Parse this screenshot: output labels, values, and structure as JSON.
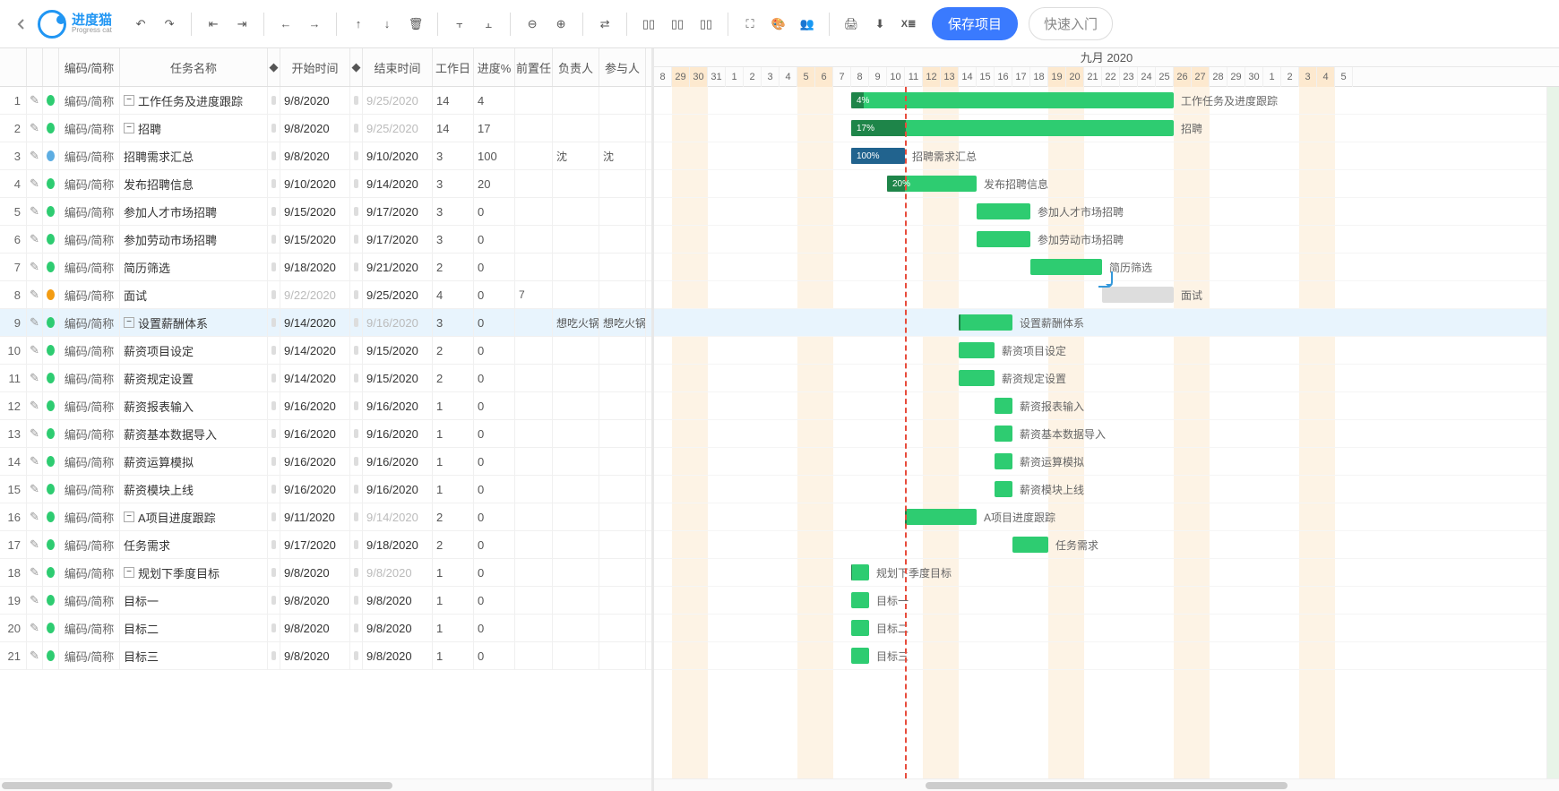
{
  "brand": {
    "zh": "进度猫",
    "en": "Progress cat"
  },
  "toolbar": {
    "save": "保存项目",
    "quick": "快速入门",
    "icons": [
      "undo",
      "redo",
      "outdent",
      "indent",
      "left",
      "right",
      "up",
      "down",
      "delete",
      "align-top",
      "align-bottom",
      "zoom-out",
      "zoom-in",
      "link",
      "col1",
      "col2",
      "col3",
      "fullscreen",
      "palette",
      "team",
      "print",
      "download",
      "excel"
    ]
  },
  "columns": {
    "code": "编码/简称",
    "name": "任务名称",
    "start": "开始时间",
    "end": "结束时间",
    "wd": "工作日",
    "pg": "进度%",
    "pre": "前置任",
    "mgr": "负责人",
    "mem": "参与人"
  },
  "rows": [
    {
      "n": 1,
      "color": "green",
      "lvl": 0,
      "exp": true,
      "name": "工作任务及进度跟踪",
      "s": "9/8/2020",
      "e": "9/25/2020",
      "edim": true,
      "wd": "14",
      "pg": "4",
      "pgdim": true,
      "start": 8,
      "end": 25,
      "prog": 4,
      "summary": true
    },
    {
      "n": 2,
      "color": "green",
      "lvl": 1,
      "exp": true,
      "name": "招聘",
      "s": "9/8/2020",
      "e": "9/25/2020",
      "edim": true,
      "wd": "14",
      "pg": "17",
      "start": 8,
      "end": 25,
      "prog": 17,
      "summary": true
    },
    {
      "n": 3,
      "color": "blue",
      "lvl": 2,
      "name": "招聘需求汇总",
      "s": "9/8/2020",
      "e": "9/10/2020",
      "wd": "3",
      "pg": "100",
      "mgr": "沈",
      "mem": "沈",
      "start": 8,
      "end": 10,
      "prog": 100,
      "blue": true
    },
    {
      "n": 4,
      "color": "green",
      "lvl": 2,
      "name": "发布招聘信息",
      "s": "9/10/2020",
      "e": "9/14/2020",
      "wd": "3",
      "pg": "20",
      "start": 10,
      "end": 14,
      "prog": 20
    },
    {
      "n": 5,
      "color": "green",
      "lvl": 2,
      "name": "参加人才市场招聘",
      "s": "9/15/2020",
      "e": "9/17/2020",
      "wd": "3",
      "pg": "0",
      "start": 15,
      "end": 17
    },
    {
      "n": 6,
      "color": "green",
      "lvl": 2,
      "name": "参加劳动市场招聘",
      "s": "9/15/2020",
      "e": "9/17/2020",
      "wd": "3",
      "pg": "0",
      "start": 15,
      "end": 17
    },
    {
      "n": 7,
      "color": "green",
      "lvl": 2,
      "name": "简历筛选",
      "s": "9/18/2020",
      "e": "9/21/2020",
      "wd": "2",
      "pg": "0",
      "start": 18,
      "end": 21
    },
    {
      "n": 8,
      "color": "orange",
      "lvl": 2,
      "name": "面试",
      "s": "9/22/2020",
      "sdim": true,
      "e": "9/25/2020",
      "wd": "4",
      "pg": "0",
      "pre": "7",
      "start": 22,
      "end": 25,
      "grey": true,
      "linkfrom": 7
    },
    {
      "n": 9,
      "color": "green",
      "lvl": 1,
      "exp": true,
      "sel": true,
      "name": "设置薪酬体系",
      "s": "9/14/2020",
      "e": "9/16/2020",
      "edim": true,
      "wd": "3",
      "wddim": true,
      "pg": "0",
      "mgr": "想吃火锅",
      "mem": "想吃火锅",
      "start": 14,
      "end": 16,
      "summary": true
    },
    {
      "n": 10,
      "color": "green",
      "lvl": 2,
      "name": "薪资项目设定",
      "s": "9/14/2020",
      "e": "9/15/2020",
      "wd": "2",
      "pg": "0",
      "start": 14,
      "end": 15
    },
    {
      "n": 11,
      "color": "green",
      "lvl": 2,
      "name": "薪资规定设置",
      "s": "9/14/2020",
      "e": "9/15/2020",
      "wd": "2",
      "pg": "0",
      "start": 14,
      "end": 15
    },
    {
      "n": 12,
      "color": "green",
      "lvl": 2,
      "name": "薪资报表输入",
      "s": "9/16/2020",
      "e": "9/16/2020",
      "wd": "1",
      "pg": "0",
      "start": 16,
      "end": 16
    },
    {
      "n": 13,
      "color": "green",
      "lvl": 2,
      "name": "薪资基本数据导入",
      "s": "9/16/2020",
      "e": "9/16/2020",
      "wd": "1",
      "pg": "0",
      "start": 16,
      "end": 16
    },
    {
      "n": 14,
      "color": "green",
      "lvl": 2,
      "name": "薪资运算模拟",
      "s": "9/16/2020",
      "e": "9/16/2020",
      "wd": "1",
      "pg": "0",
      "start": 16,
      "end": 16
    },
    {
      "n": 15,
      "color": "green",
      "lvl": 2,
      "name": "薪资模块上线",
      "s": "9/16/2020",
      "e": "9/16/2020",
      "wd": "1",
      "pg": "0",
      "start": 16,
      "end": 16
    },
    {
      "n": 16,
      "color": "green",
      "lvl": 1,
      "exp": true,
      "name": "A项目进度跟踪",
      "s": "9/11/2020",
      "e": "9/14/2020",
      "edim": true,
      "wd": "2",
      "wddim": true,
      "pg": "0",
      "start": 11,
      "end": 14,
      "summary": true
    },
    {
      "n": 17,
      "color": "green",
      "lvl": 2,
      "name": "任务需求",
      "s": "9/17/2020",
      "e": "9/18/2020",
      "wd": "2",
      "pg": "0",
      "start": 17,
      "end": 18
    },
    {
      "n": 18,
      "color": "green",
      "lvl": 1,
      "exp": true,
      "name": "规划下季度目标",
      "s": "9/8/2020",
      "e": "9/8/2020",
      "edim": true,
      "wd": "1",
      "wddim": true,
      "pg": "0",
      "start": 8,
      "end": 8,
      "summary": true
    },
    {
      "n": 19,
      "color": "green",
      "lvl": 2,
      "name": "目标一",
      "s": "9/8/2020",
      "e": "9/8/2020",
      "wd": "1",
      "pg": "0",
      "start": 8,
      "end": 8
    },
    {
      "n": 20,
      "color": "green",
      "lvl": 2,
      "name": "目标二",
      "s": "9/8/2020",
      "e": "9/8/2020",
      "wd": "1",
      "pg": "0",
      "start": 8,
      "end": 8
    },
    {
      "n": 21,
      "color": "green",
      "lvl": 2,
      "name": "目标三",
      "s": "9/8/2020",
      "e": "9/8/2020",
      "wd": "1",
      "pg": "0",
      "start": 8,
      "end": 8
    }
  ],
  "timeline": {
    "month": "九月 2020",
    "dayWidth": 20,
    "days": [
      {
        "l": "8",
        "wk": false
      },
      {
        "l": "29",
        "wk": true
      },
      {
        "l": "30",
        "wk": true
      },
      {
        "l": "31",
        "wk": false
      },
      {
        "l": "1",
        "wk": false
      },
      {
        "l": "2",
        "wk": false
      },
      {
        "l": "3",
        "wk": false
      },
      {
        "l": "4",
        "wk": false
      },
      {
        "l": "5",
        "wk": true
      },
      {
        "l": "6",
        "wk": true
      },
      {
        "l": "7",
        "wk": false
      },
      {
        "l": "8",
        "wk": false
      },
      {
        "l": "9",
        "wk": false
      },
      {
        "l": "10",
        "wk": false
      },
      {
        "l": "11",
        "wk": false
      },
      {
        "l": "12",
        "wk": true
      },
      {
        "l": "13",
        "wk": true
      },
      {
        "l": "14",
        "wk": false
      },
      {
        "l": "15",
        "wk": false
      },
      {
        "l": "16",
        "wk": false
      },
      {
        "l": "17",
        "wk": false
      },
      {
        "l": "18",
        "wk": false
      },
      {
        "l": "19",
        "wk": true
      },
      {
        "l": "20",
        "wk": true
      },
      {
        "l": "21",
        "wk": false
      },
      {
        "l": "22",
        "wk": false
      },
      {
        "l": "23",
        "wk": false
      },
      {
        "l": "24",
        "wk": false
      },
      {
        "l": "25",
        "wk": false
      },
      {
        "l": "26",
        "wk": true
      },
      {
        "l": "27",
        "wk": true
      },
      {
        "l": "28",
        "wk": false
      },
      {
        "l": "29",
        "wk": false
      },
      {
        "l": "30",
        "wk": false
      },
      {
        "l": "1",
        "wk": false
      },
      {
        "l": "2",
        "wk": false
      },
      {
        "l": "3",
        "wk": true
      },
      {
        "l": "4",
        "wk": true
      },
      {
        "l": "5",
        "wk": false
      }
    ],
    "sep8Index": 11,
    "todayIndex": 13
  }
}
